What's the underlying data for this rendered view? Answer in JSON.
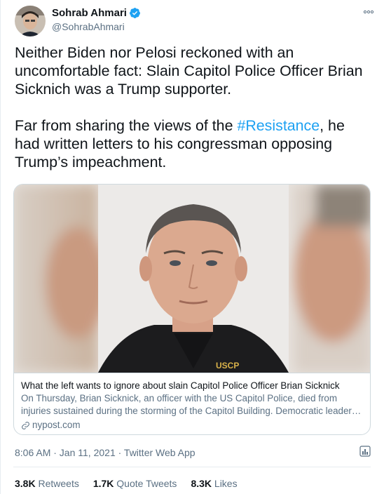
{
  "author": {
    "display_name": "Sohrab Ahmari",
    "handle": "@SohrabAhmari"
  },
  "tweet": {
    "paragraph1": "Neither Biden nor Pelosi reckoned with an uncomfortable fact: Slain Capitol Police Officer Brian Sicknich was a Trump supporter.",
    "paragraph2_before": "Far from sharing the views of the ",
    "hashtag": "#Resistance",
    "paragraph2_after": ", he had written letters to his congressman opposing Trump’s impeachment."
  },
  "card": {
    "title": "What the left wants to ignore about slain Capitol Police Officer Brian Sicknick",
    "description": "On Thursday, Brian Sicknick, an officer with the US Capitol Police, died from injuries sustained during the storming of the Capitol Building. Democratic leader…",
    "domain": "nypost.com"
  },
  "meta": {
    "time_date": "8:06 AM · Jan 11, 2021 · Twitter Web App"
  },
  "stats": {
    "retweets_count": "3.8K",
    "retweets_label": "Retweets",
    "quote_count": "1.7K",
    "quote_label": "Quote Tweets",
    "likes_count": "8.3K",
    "likes_label": "Likes"
  },
  "colors": {
    "accent": "#1da1f2",
    "secondary_text": "#5b7083"
  },
  "icons": [
    "verified-badge-icon",
    "more-icon",
    "link-icon",
    "analytics-icon"
  ]
}
